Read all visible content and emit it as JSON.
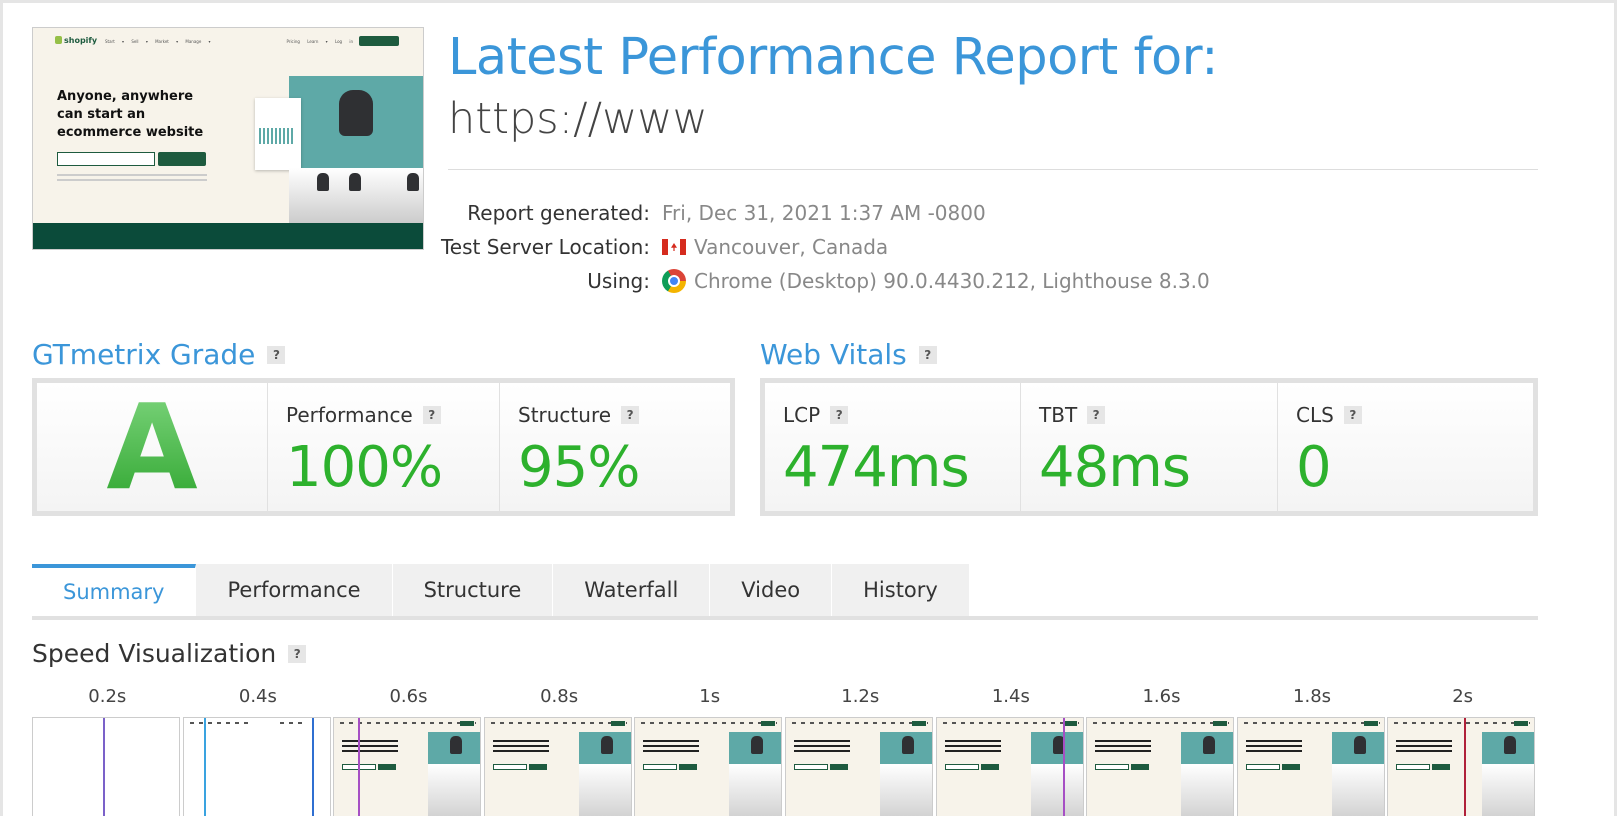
{
  "thumbnail": {
    "logo": "shopify",
    "nav_left": "Start ▾ Sell ▾ Market ▾ Manage ▾",
    "nav_right": "Pricing Learn ▾ Log in",
    "headline": "Anyone, anywhere can start an ecommerce website"
  },
  "report": {
    "title": "Latest Performance Report for:",
    "url": "https://www",
    "generated_label": "Report generated:",
    "generated_value": "Fri, Dec 31, 2021 1:37 AM -0800",
    "location_label": "Test Server Location:",
    "location_value": "Vancouver, Canada",
    "using_label": "Using:",
    "using_value": "Chrome (Desktop) 90.0.4430.212, Lighthouse 8.3.0"
  },
  "gtmetrix": {
    "heading": "GTmetrix Grade",
    "help": "?",
    "grade": "A",
    "performance_label": "Performance",
    "performance_value": "100%",
    "structure_label": "Structure",
    "structure_value": "95%"
  },
  "vitals": {
    "heading": "Web Vitals",
    "help": "?",
    "lcp_label": "LCP",
    "lcp_value": "474ms",
    "tbt_label": "TBT",
    "tbt_value": "48ms",
    "cls_label": "CLS",
    "cls_value": "0"
  },
  "tabs": [
    {
      "label": "Summary",
      "active": true
    },
    {
      "label": "Performance"
    },
    {
      "label": "Structure"
    },
    {
      "label": "Waterfall"
    },
    {
      "label": "Video"
    },
    {
      "label": "History"
    }
  ],
  "speed": {
    "heading": "Speed Visualization",
    "help": "?",
    "ticks": [
      "0.2s",
      "0.4s",
      "0.6s",
      "0.8s",
      "1s",
      "1.2s",
      "1.4s",
      "1.6s",
      "1.8s",
      "2s"
    ]
  },
  "colors": {
    "accent_blue": "#3b96d9",
    "score_green": "#2db12d"
  }
}
